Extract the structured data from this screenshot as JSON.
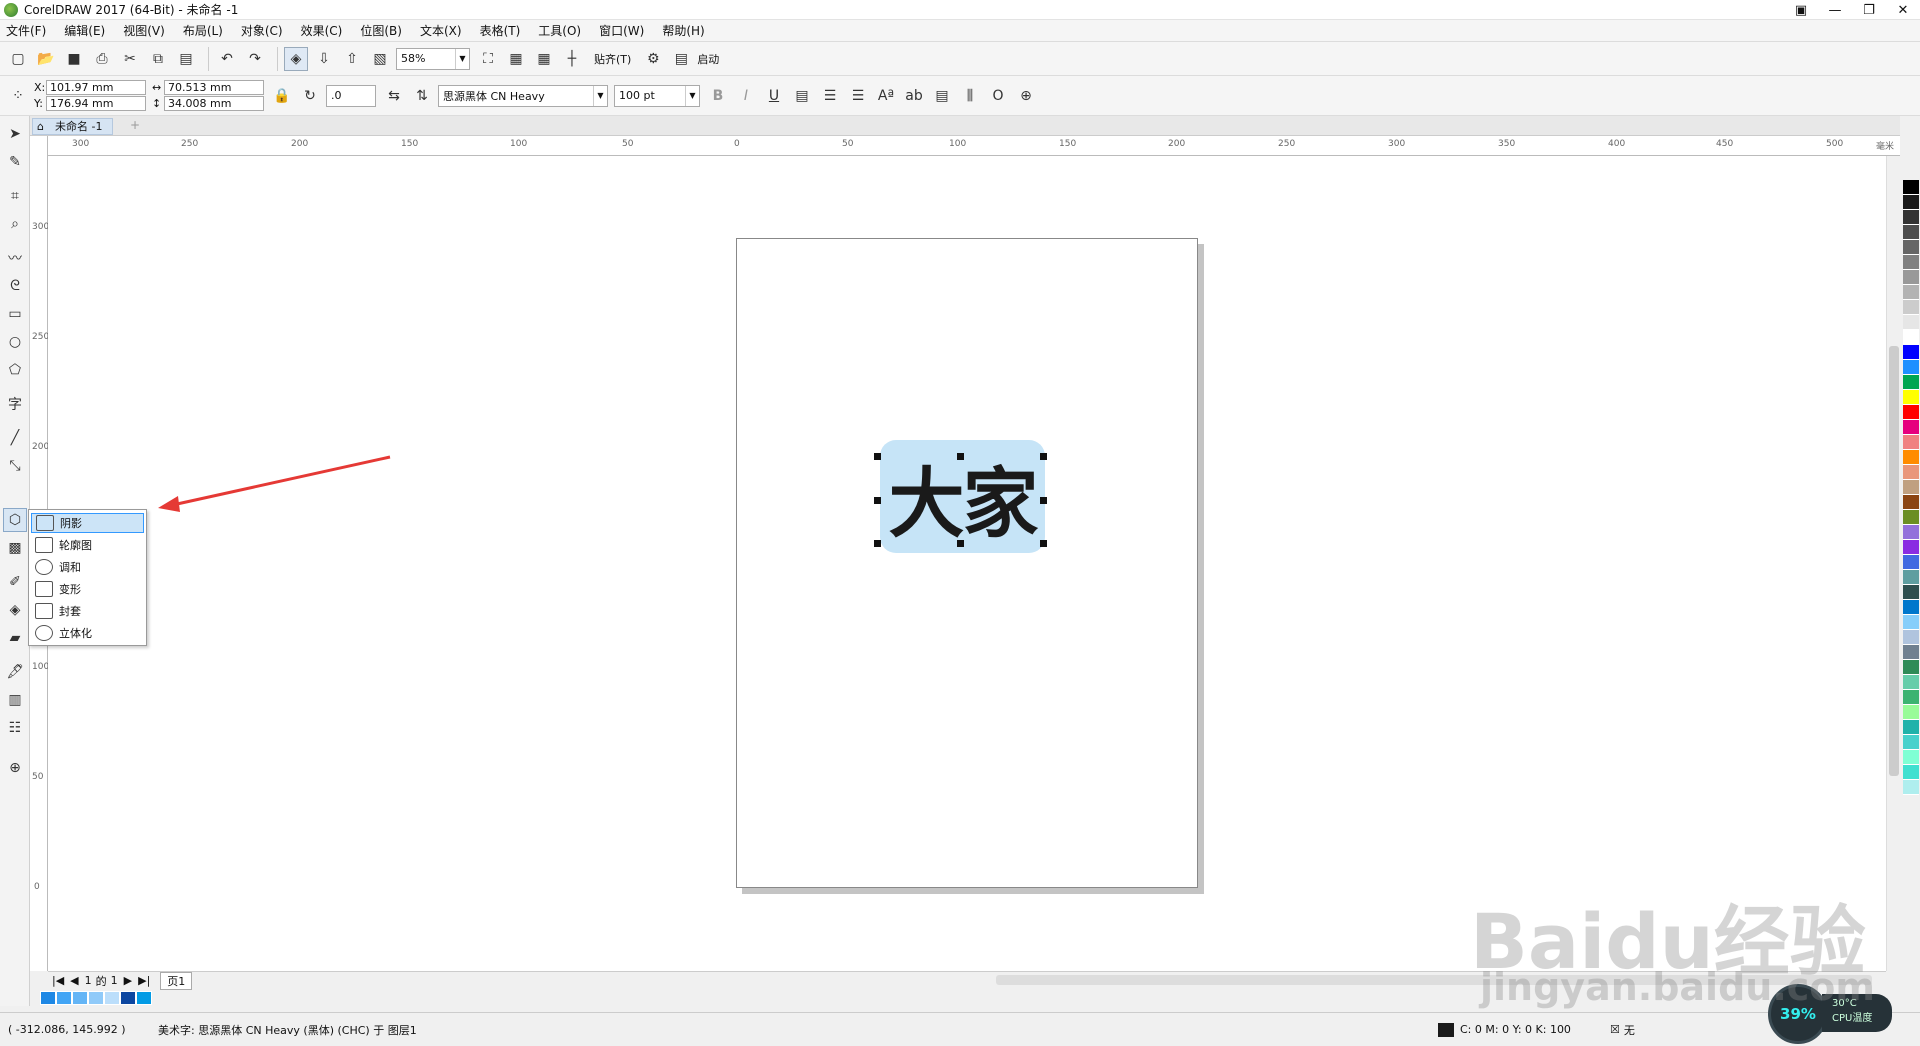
{
  "window": {
    "title": "CorelDRAW 2017 (64-Bit) - 未命名 -1"
  },
  "menu": [
    "文件(F)",
    "编辑(E)",
    "视图(V)",
    "布局(L)",
    "对象(C)",
    "效果(C)",
    "位图(B)",
    "文本(X)",
    "表格(T)",
    "工具(O)",
    "窗口(W)",
    "帮助(H)"
  ],
  "toolbar1": {
    "zoom": "58%",
    "snap_label": "贴齐(T)",
    "launch_label": "启动"
  },
  "property_bar": {
    "x": "101.97 mm",
    "y": "176.94 mm",
    "width": "70.513 mm",
    "height": "34.008 mm",
    "rotation": ".0",
    "font": "思源黑体 CN Heavy",
    "size": "100 pt"
  },
  "doc_tab": "未命名 -1",
  "canvas": {
    "text": "大家"
  },
  "flyout": [
    "阴影",
    "轮廓图",
    "调和",
    "变形",
    "封套",
    "立体化"
  ],
  "pager": {
    "current": "1",
    "of": "的",
    "total": "1",
    "page_tab": "页1"
  },
  "status": {
    "coords": "( -312.086, 145.992 )",
    "object": "美术字: 思源黑体 CN Heavy (黑体) (CHC) 于 图层1",
    "fill": "C: 0 M: 0 Y: 0 K: 100",
    "outline": "无"
  },
  "cpu": {
    "percent": "39%",
    "temp": "30°C",
    "label": "CPU温度"
  },
  "watermark": {
    "text": "Baidu经验",
    "url": "jingyan.baidu.com"
  },
  "ruler_h": [
    "300",
    "250",
    "200",
    "150",
    "100",
    "50",
    "0",
    "50",
    "100",
    "150",
    "200",
    "250",
    "300",
    "350",
    "400",
    "450",
    "500",
    "毫米"
  ],
  "ruler_v": [
    "300",
    "250",
    "200",
    "150",
    "100",
    "50",
    "0"
  ],
  "palette_colors": [
    "#000000",
    "#1a1a1a",
    "#333333",
    "#4d4d4d",
    "#666666",
    "#808080",
    "#999999",
    "#b3b3b3",
    "#cccccc",
    "#e6e6e6",
    "#ffffff",
    "#0000ff",
    "#1e90ff",
    "#00a651",
    "#ffff00",
    "#ff0000",
    "#e6007e",
    "#f08080",
    "#ff8c00",
    "#e9967a",
    "#c0a080",
    "#8b4513",
    "#6b8e23",
    "#9370db",
    "#8a2be2",
    "#4169e1",
    "#5f9ea0",
    "#2f4f4f",
    "#0077cc",
    "#87cefa",
    "#b0c4de",
    "#708090",
    "#2e8b57",
    "#66cdaa",
    "#3cb371",
    "#98fb98",
    "#20b2aa",
    "#48d1cc",
    "#7fffd4",
    "#40e0d0",
    "#afeeee"
  ],
  "doc_palette": [
    "#1e88e5",
    "#42a5f5",
    "#64b5f6",
    "#90caf9",
    "#bbdefb",
    "#0d47a1",
    "#039be5"
  ]
}
